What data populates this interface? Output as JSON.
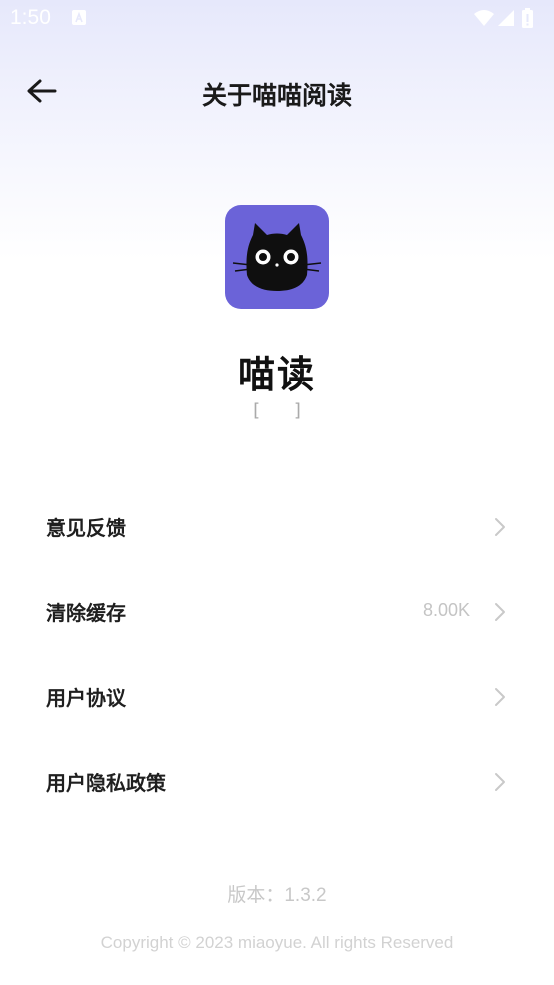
{
  "status_bar": {
    "time": "1:50"
  },
  "header": {
    "title": "关于喵喵阅读"
  },
  "app": {
    "name": "喵读",
    "subtitle": "[ ]"
  },
  "menu": {
    "items": [
      {
        "label": "意见反馈",
        "value": ""
      },
      {
        "label": "清除缓存",
        "value": "8.00K"
      },
      {
        "label": "用户协议",
        "value": ""
      },
      {
        "label": "用户隐私政策",
        "value": ""
      }
    ]
  },
  "footer": {
    "version": "版本：1.3.2",
    "copyright": "Copyright © 2023 miaoyue. All rights Reserved"
  },
  "colors": {
    "accent": "#6b63d8",
    "header_gradient_top": "#e6e8fb",
    "muted_text": "#c4c4c4"
  },
  "icons": {
    "back": "arrow-left-icon",
    "chevron": "chevron-right-icon",
    "logo": "black-cat-logo",
    "wifi": "wifi-icon",
    "signal": "signal-icon",
    "battery": "battery-icon"
  }
}
